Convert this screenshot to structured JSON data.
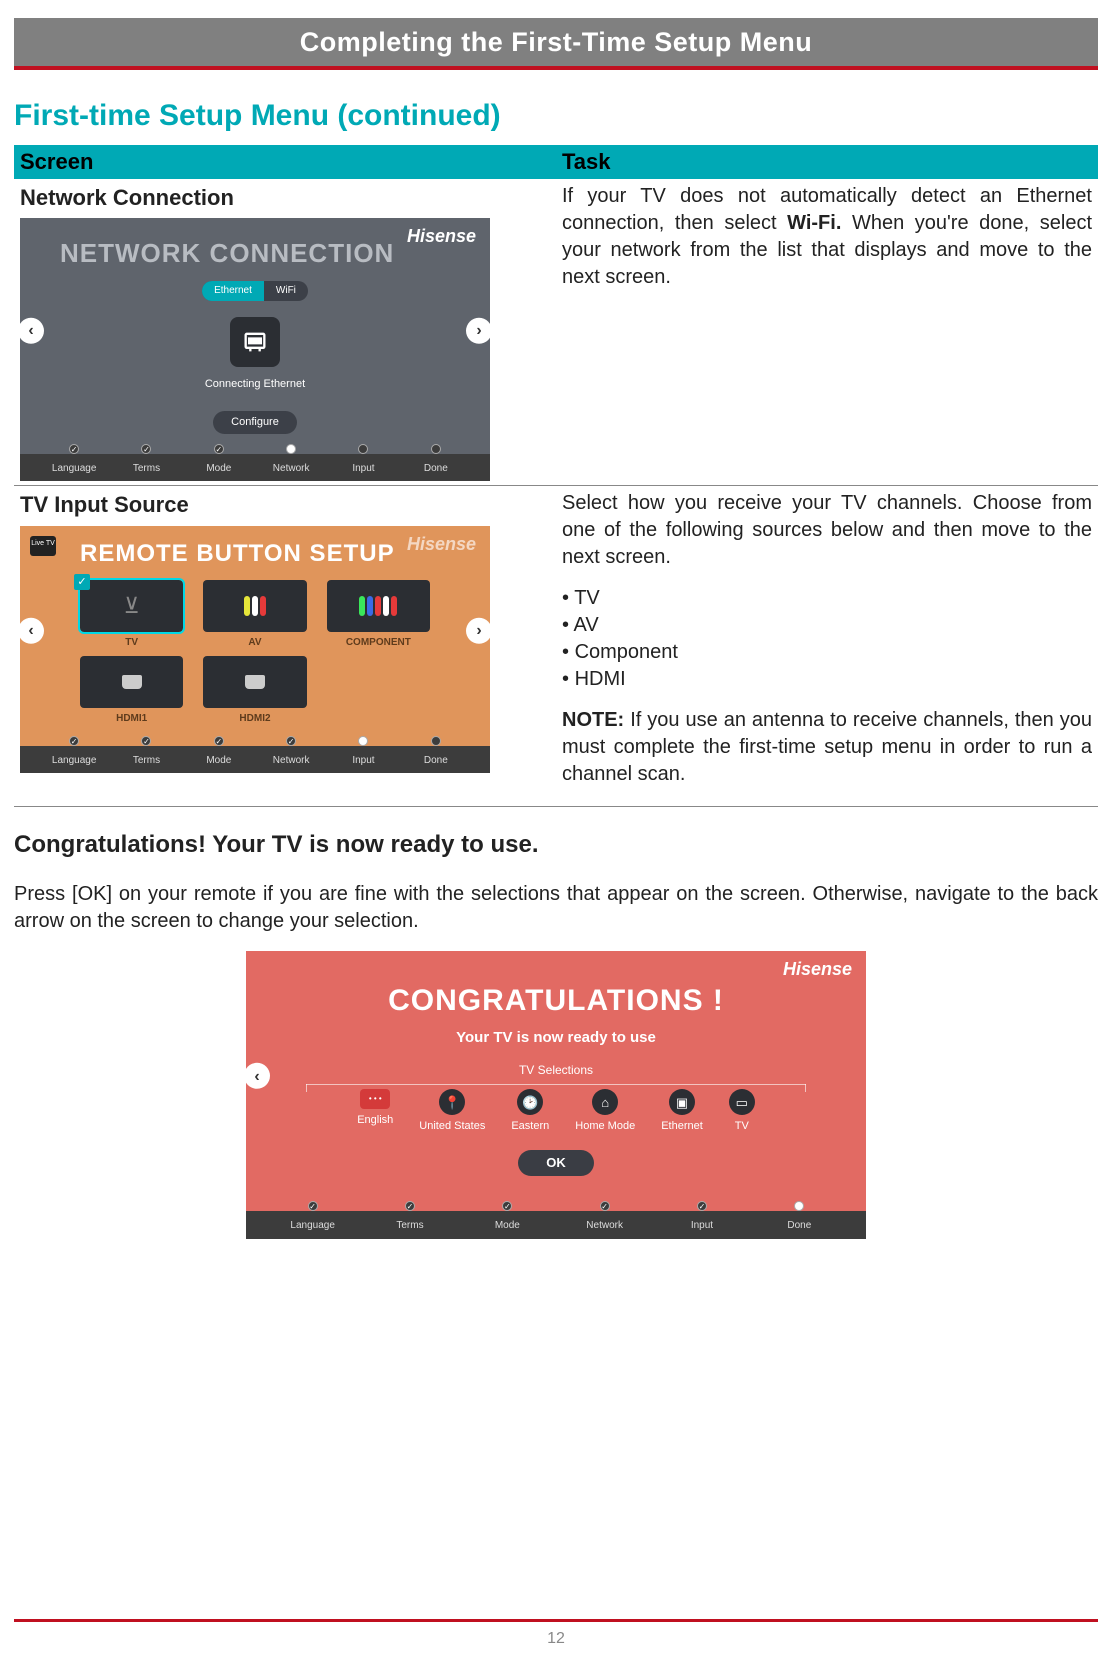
{
  "header": {
    "title": "Completing the First-Time Setup Menu"
  },
  "section_title": "First-time Setup Menu (continued)",
  "table_headers": {
    "screen": "Screen",
    "task": "Task"
  },
  "rows": {
    "network": {
      "label": "Network Connection",
      "screen": {
        "title": "NETWORK CONNECTION",
        "brand": "Hisense",
        "toggle": {
          "ethernet": "Ethernet",
          "wifi": "WiFi"
        },
        "status": "Connecting Ethernet",
        "button": "Configure"
      },
      "task_html": "If your TV does not automatically detect an Ethernet connection, then select <b>Wi-Fi.</b> When you're done, select your network from the list that displays and move to the next screen."
    },
    "input": {
      "label": "TV Input Source",
      "screen": {
        "title": "REMOTE BUTTON SETUP",
        "brand": "Hisense",
        "badge": "Live TV",
        "tiles": {
          "tv": "TV",
          "av": "AV",
          "component": "COMPONENT",
          "hdmi1": "HDMI1",
          "hdmi2": "HDMI2"
        }
      },
      "task_intro": "Select how you receive your TV channels. Choose from one of the following sources below and then move to the next screen.",
      "task_items": [
        "TV",
        "AV",
        "Component",
        "HDMI"
      ],
      "task_note_label": "NOTE:",
      "task_note": " If you use an antenna to receive channels, then you must complete the first-time setup menu in order to run a channel scan."
    }
  },
  "progress_steps": [
    "Language",
    "Terms",
    "Mode",
    "Network",
    "Input",
    "Done"
  ],
  "congrats_heading": "Congratulations! Your TV is now ready to use.",
  "congrats_para": "Press [OK] on your remote if you are fine with the selections that appear on the screen. Otherwise, navigate to the back arrow on the screen to change your selection.",
  "congrats_screen": {
    "brand": "Hisense",
    "title": "CONGRATULATIONS !",
    "subtitle": "Your TV is now ready to use",
    "selections_label": "TV Selections",
    "items": {
      "english": "English",
      "united_states": "United States",
      "eastern": "Eastern",
      "home_mode": "Home Mode",
      "ethernet": "Ethernet",
      "tv": "TV"
    },
    "ok": "OK"
  },
  "page_number": "12"
}
